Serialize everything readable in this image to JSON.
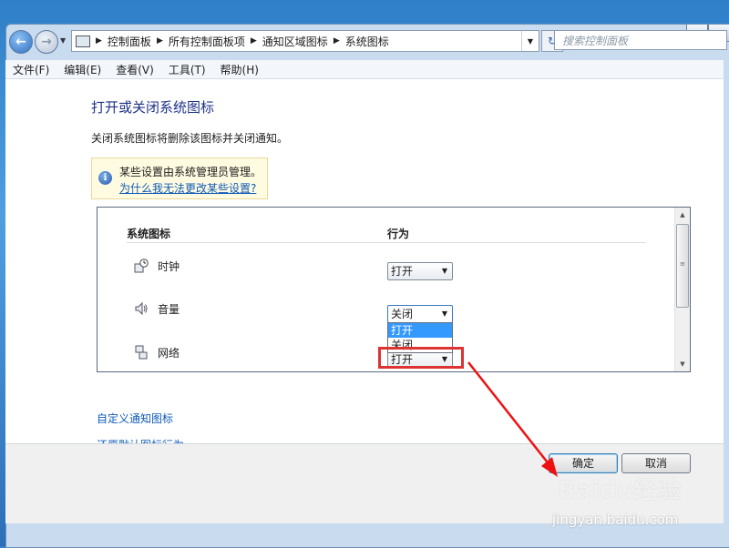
{
  "window": {
    "minimize": "▬",
    "maximize": "▭"
  },
  "address": {
    "crumbs": [
      "控制面板",
      "所有控制面板项",
      "通知区域图标",
      "系统图标"
    ],
    "search_placeholder": "搜索控制面板"
  },
  "menu": [
    "文件(F)",
    "编辑(E)",
    "查看(V)",
    "工具(T)",
    "帮助(H)"
  ],
  "page": {
    "title": "打开或关闭系统图标",
    "description": "关闭系统图标将删除该图标并关闭通知。",
    "info_text": "某些设置由系统管理员管理。",
    "info_link": "为什么我无法更改某些设置?"
  },
  "table": {
    "col_icon": "系统图标",
    "col_behavior": "行为",
    "rows": [
      {
        "name": "时钟",
        "icon": "clock-icon",
        "value": "打开"
      },
      {
        "name": "音量",
        "icon": "volume-icon",
        "value": "关闭"
      },
      {
        "name": "网络",
        "icon": "network-icon",
        "value": "打开"
      }
    ],
    "dropdown_options": [
      "打开",
      "关闭"
    ]
  },
  "links": {
    "customize": "自定义通知图标",
    "restore": "还原默认图标行为"
  },
  "buttons": {
    "ok": "确定",
    "cancel": "取消"
  },
  "watermark": {
    "logo": "Baidu经验",
    "url": "jingyan.baidu.com"
  },
  "colors": {
    "link": "#0f5bb8",
    "title": "#1e3287",
    "highlight": "#dd3333",
    "selection": "#3399ff"
  }
}
